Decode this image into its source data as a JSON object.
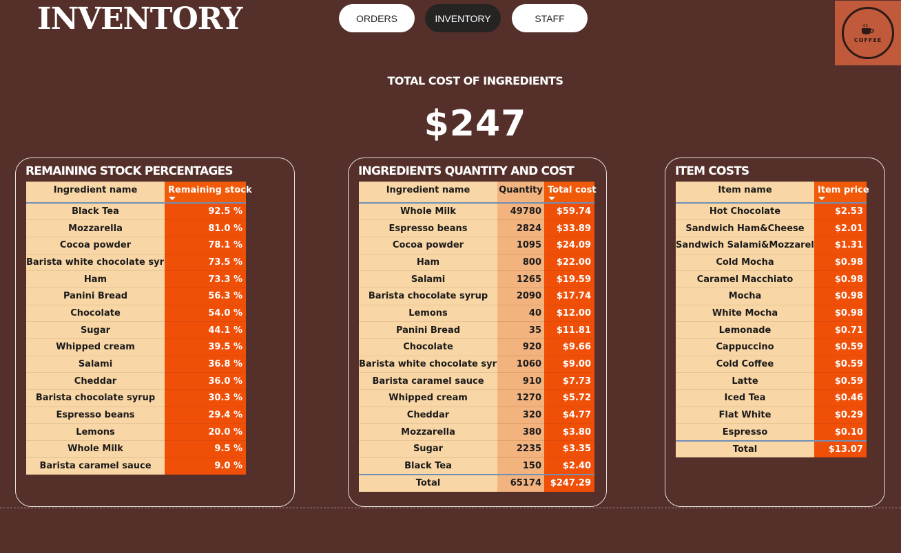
{
  "header": {
    "title": "INVENTORY",
    "nav": {
      "orders": "ORDERS",
      "inventory": "INVENTORY",
      "staff": "STAFF"
    },
    "logo_text": "COFFEE"
  },
  "kpi": {
    "title": "TOTAL COST OF INGREDIENTS",
    "value": "$247"
  },
  "colors": {
    "background": "#55302b",
    "accent_orange": "#f04f08",
    "cream": "#f9d6a5",
    "quantity_peach": "#f2b37f"
  },
  "stock": {
    "title": "REMAINING STOCK PERCENTAGES",
    "columns": [
      "Ingredient name",
      "Remaining stock"
    ],
    "rows": [
      [
        "Black Tea",
        "92.5 %"
      ],
      [
        "Mozzarella",
        "81.0 %"
      ],
      [
        "Cocoa powder",
        "78.1 %"
      ],
      [
        "Barista white chocolate syrup",
        "73.5 %"
      ],
      [
        "Ham",
        "73.3 %"
      ],
      [
        "Panini Bread",
        "56.3 %"
      ],
      [
        "Chocolate",
        "54.0 %"
      ],
      [
        "Sugar",
        "44.1 %"
      ],
      [
        "Whipped cream",
        "39.5 %"
      ],
      [
        "Salami",
        "36.8 %"
      ],
      [
        "Cheddar",
        "36.0 %"
      ],
      [
        "Barista chocolate syrup",
        "30.3 %"
      ],
      [
        "Espresso beans",
        "29.4 %"
      ],
      [
        "Lemons",
        "20.0 %"
      ],
      [
        "Whole Milk",
        "9.5 %"
      ],
      [
        "Barista caramel sauce",
        "9.0 %"
      ]
    ]
  },
  "ingredients": {
    "title": "INGREDIENTS QUANTITY AND COST",
    "columns": [
      "Ingredient name",
      "Quantity",
      "Total cost"
    ],
    "rows": [
      [
        "Whole Milk",
        "49780",
        "$59.74"
      ],
      [
        "Espresso beans",
        "2824",
        "$33.89"
      ],
      [
        "Cocoa powder",
        "1095",
        "$24.09"
      ],
      [
        "Ham",
        "800",
        "$22.00"
      ],
      [
        "Salami",
        "1265",
        "$19.59"
      ],
      [
        "Barista chocolate syrup",
        "2090",
        "$17.74"
      ],
      [
        "Lemons",
        "40",
        "$12.00"
      ],
      [
        "Panini Bread",
        "35",
        "$11.81"
      ],
      [
        "Chocolate",
        "920",
        "$9.66"
      ],
      [
        "Barista white chocolate syrup",
        "1060",
        "$9.00"
      ],
      [
        "Barista caramel sauce",
        "910",
        "$7.73"
      ],
      [
        "Whipped cream",
        "1270",
        "$5.72"
      ],
      [
        "Cheddar",
        "320",
        "$4.77"
      ],
      [
        "Mozzarella",
        "380",
        "$3.80"
      ],
      [
        "Sugar",
        "2235",
        "$3.35"
      ],
      [
        "Black Tea",
        "150",
        "$2.40"
      ]
    ],
    "total": [
      "Total",
      "65174",
      "$247.29"
    ]
  },
  "items": {
    "title": "ITEM COSTS",
    "columns": [
      "Item name",
      "Item price"
    ],
    "rows": [
      [
        "Hot Chocolate",
        "$2.53"
      ],
      [
        "Sandwich Ham&Cheese",
        "$2.01"
      ],
      [
        "Sandwich Salami&Mozzarella",
        "$1.31"
      ],
      [
        "Cold Mocha",
        "$0.98"
      ],
      [
        "Caramel Macchiato",
        "$0.98"
      ],
      [
        "Mocha",
        "$0.98"
      ],
      [
        "White Mocha",
        "$0.98"
      ],
      [
        "Lemonade",
        "$0.71"
      ],
      [
        "Cappuccino",
        "$0.59"
      ],
      [
        "Cold Coffee",
        "$0.59"
      ],
      [
        "Latte",
        "$0.59"
      ],
      [
        "Iced Tea",
        "$0.46"
      ],
      [
        "Flat White",
        "$0.29"
      ],
      [
        "Espresso",
        "$0.10"
      ]
    ],
    "total": [
      "Total",
      "$13.07"
    ]
  }
}
